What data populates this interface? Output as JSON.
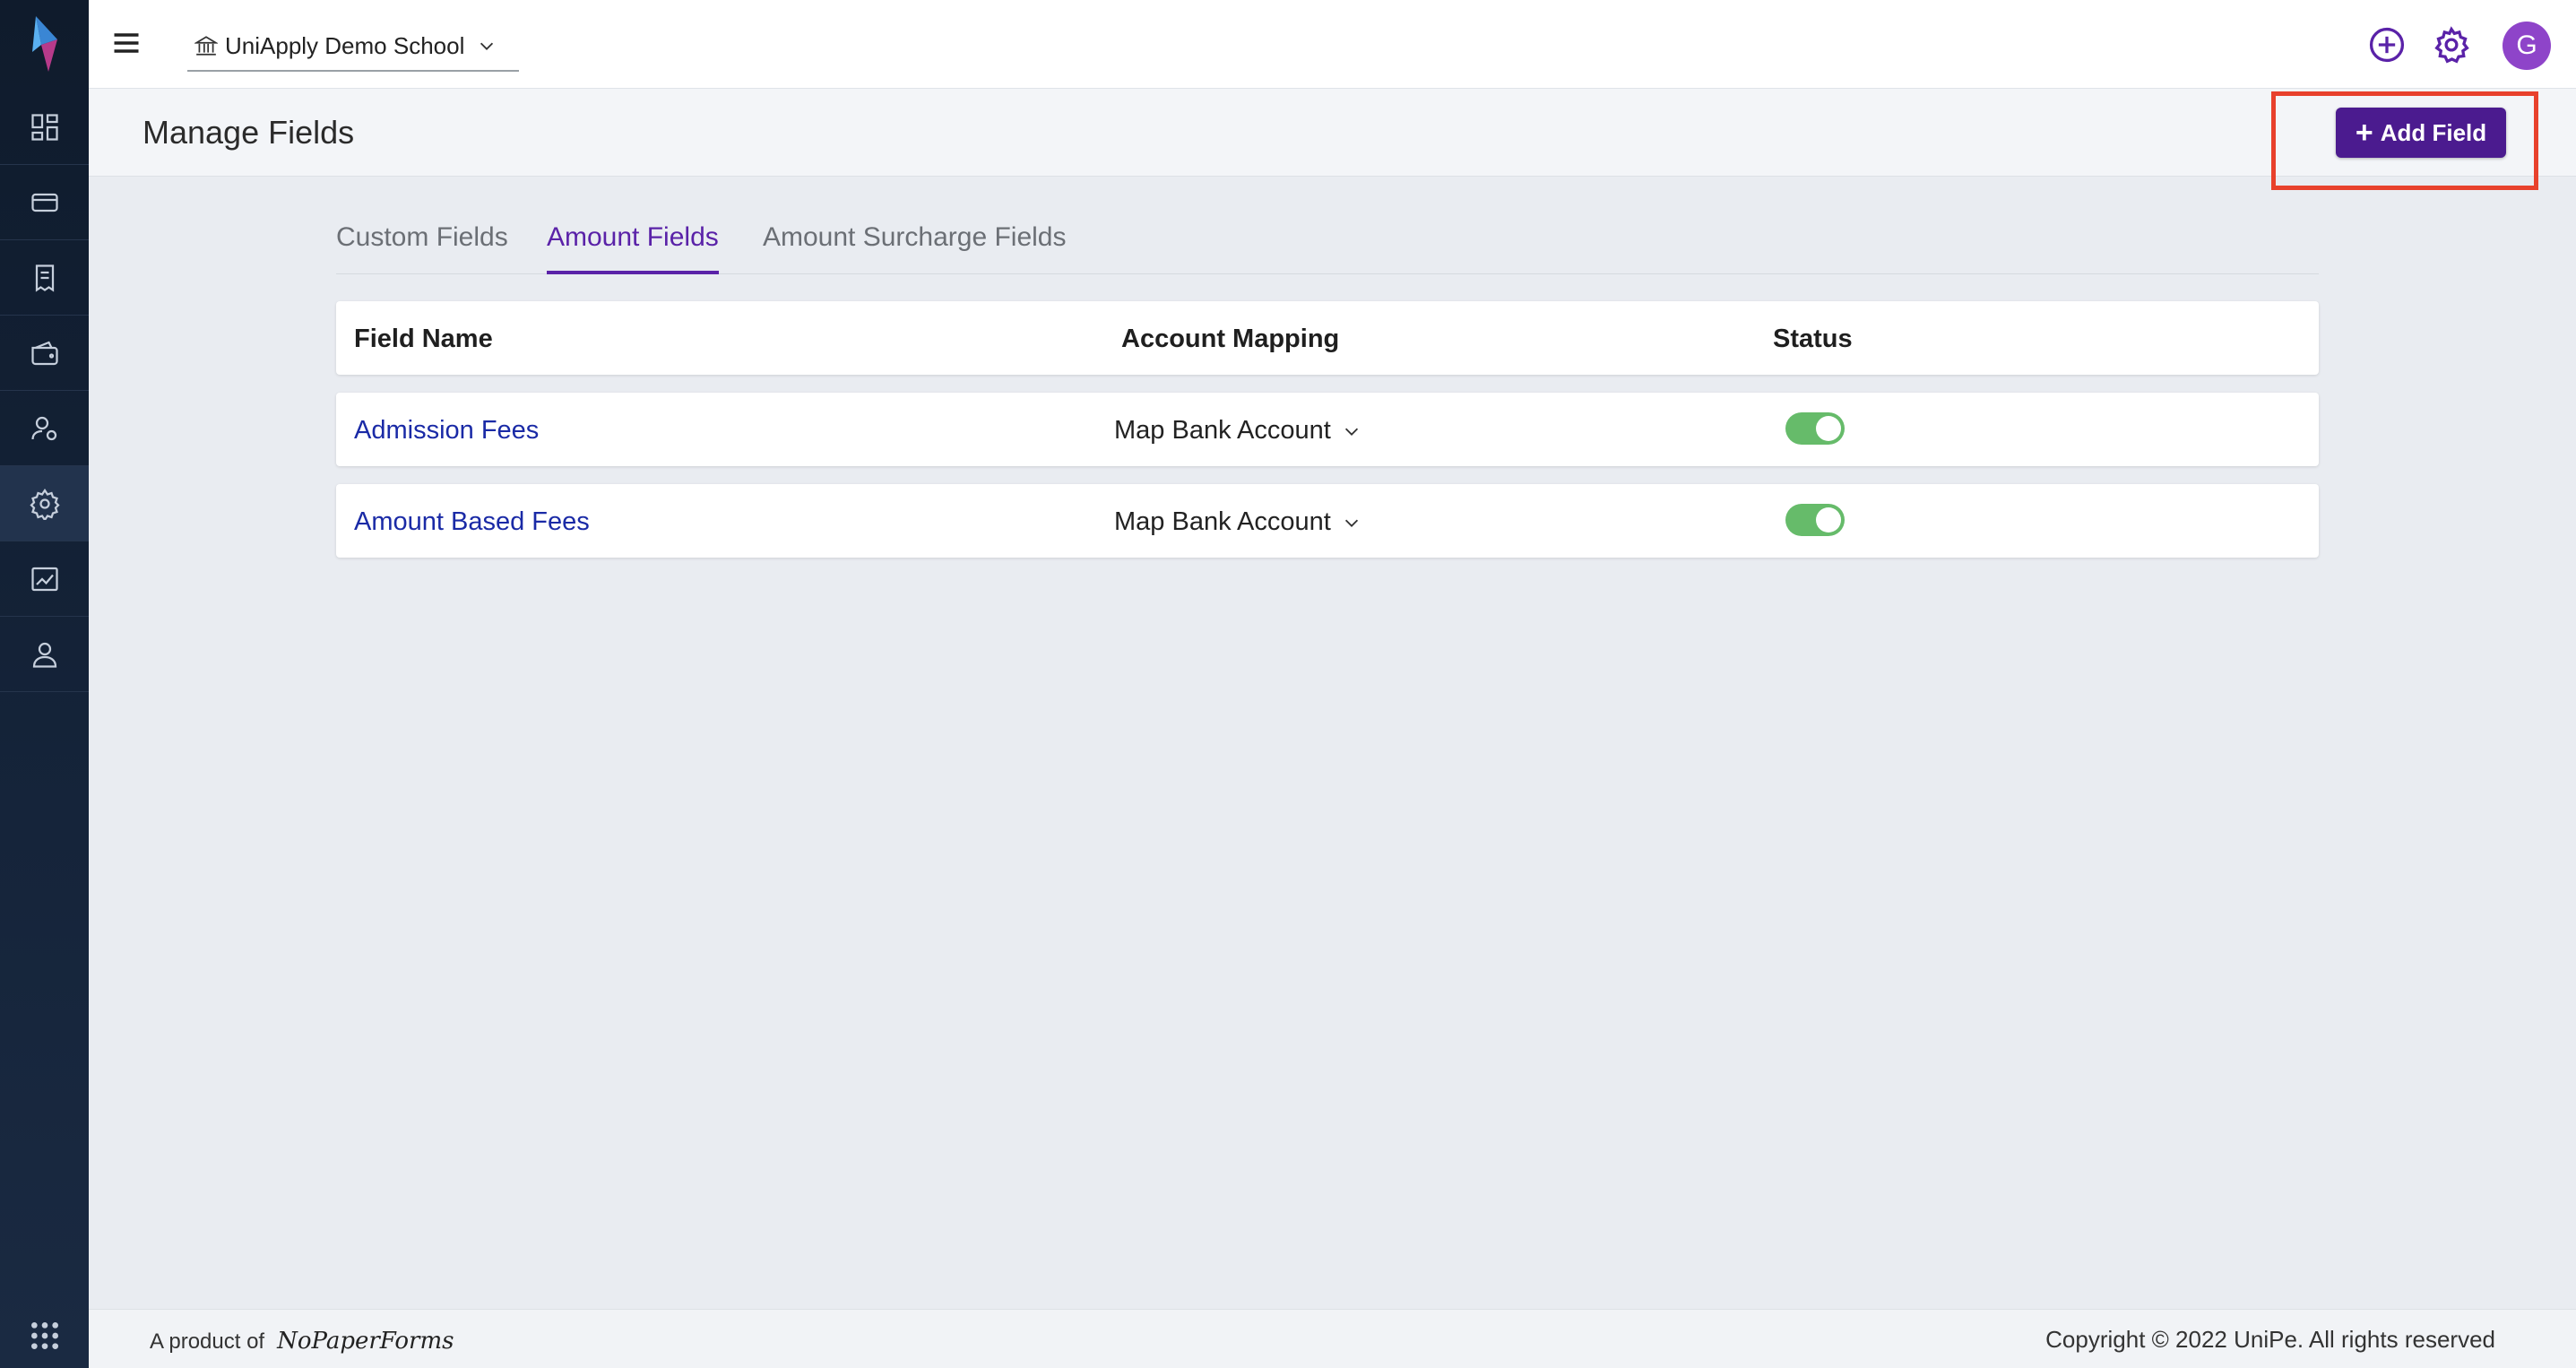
{
  "topbar": {
    "school_name": "UniApply Demo School",
    "avatar_initial": "G"
  },
  "page": {
    "title": "Manage Fields",
    "add_button_label": "Add Field"
  },
  "tabs": [
    {
      "label": "Custom Fields",
      "active": false
    },
    {
      "label": "Amount Fields",
      "active": true
    },
    {
      "label": "Amount Surcharge Fields",
      "active": false
    }
  ],
  "table": {
    "headers": [
      "Field Name",
      "Account Mapping",
      "Status"
    ],
    "rows": [
      {
        "field_name": "Admission Fees",
        "mapping": "Map Bank Account",
        "status": "on"
      },
      {
        "field_name": "Amount Based Fees",
        "mapping": "Map Bank Account",
        "status": "on"
      }
    ]
  },
  "footer": {
    "product_prefix": "A product of",
    "brand": "NoPaperForms",
    "copyright": "Copyright © 2022 UniPe. All rights reserved"
  },
  "colors": {
    "accent": "#4b1b8f",
    "active_tab": "#5a22a8",
    "toggle_on": "#66bb6a",
    "link": "#1a2aa6",
    "highlight": "#e8412c"
  }
}
